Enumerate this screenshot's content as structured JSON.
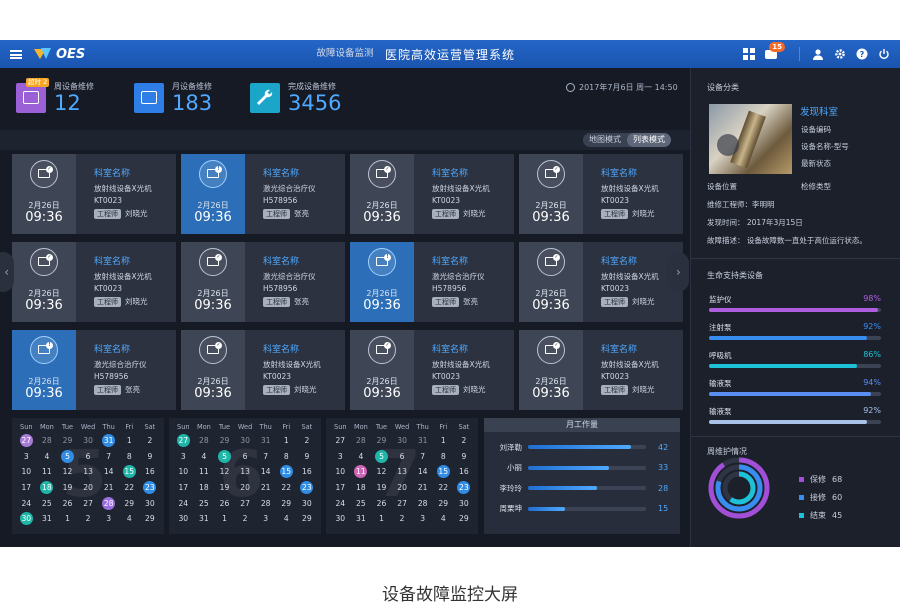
{
  "app": {
    "logo_text": "OES",
    "title": "医院高效运营管理系统",
    "message_count": "15"
  },
  "stats": [
    {
      "label": "周设备维修",
      "value": "12",
      "badge": "超时 2",
      "color": "#9b5fd6"
    },
    {
      "label": "月设备维修",
      "value": "183",
      "color": "#2f7de6"
    },
    {
      "label": "完成设备维修",
      "value": "3456",
      "color": "#1aa5c9"
    }
  ],
  "datetime": "2017年7月6日   周一   14:50",
  "monitor": {
    "title": "故障设备监测",
    "modes": [
      "地图模式",
      "列表模式"
    ],
    "active_mode": "列表模式",
    "engineer_tag": "工程师",
    "cards": [
      {
        "room": "科室名称",
        "device": "放射线设备X光机",
        "code": "KT0023",
        "engineer": "刘晓光",
        "date": "2月26日",
        "time": "09:36",
        "alert": false
      },
      {
        "room": "科室名称",
        "device": "激光综合治疗仪",
        "code": "H578956",
        "engineer": "张亮",
        "date": "2月26日",
        "time": "09:36",
        "alert": true
      },
      {
        "room": "科室名称",
        "device": "放射线设备X光机",
        "code": "KT0023",
        "engineer": "刘晓光",
        "date": "2月26日",
        "time": "09:36",
        "alert": false
      },
      {
        "room": "科室名称",
        "device": "放射线设备X光机",
        "code": "KT0023",
        "engineer": "刘晓光",
        "date": "2月26日",
        "time": "09:36",
        "alert": false
      },
      {
        "room": "科室名称",
        "device": "放射线设备X光机",
        "code": "KT0023",
        "engineer": "刘晓光",
        "date": "2月26日",
        "time": "09:36",
        "alert": false
      },
      {
        "room": "科室名称",
        "device": "激光综合治疗仪",
        "code": "H578956",
        "engineer": "张亮",
        "date": "2月26日",
        "time": "09:36",
        "alert": false
      },
      {
        "room": "科室名称",
        "device": "激光综合治疗仪",
        "code": "H578956",
        "engineer": "张亮",
        "date": "2月26日",
        "time": "09:36",
        "alert": true
      },
      {
        "room": "科室名称",
        "device": "放射线设备X光机",
        "code": "KT0023",
        "engineer": "刘晓光",
        "date": "2月26日",
        "time": "09:36",
        "alert": false
      },
      {
        "room": "科室名称",
        "device": "激光综合治疗仪",
        "code": "H578956",
        "engineer": "张亮",
        "date": "2月26日",
        "time": "09:36",
        "alert": true
      },
      {
        "room": "科室名称",
        "device": "放射线设备X光机",
        "code": "KT0023",
        "engineer": "刘晓光",
        "date": "2月26日",
        "time": "09:36",
        "alert": false
      },
      {
        "room": "科室名称",
        "device": "放射线设备X光机",
        "code": "KT0023",
        "engineer": "刘晓光",
        "date": "2月26日",
        "time": "09:36",
        "alert": false
      },
      {
        "room": "科室名称",
        "device": "放射线设备X光机",
        "code": "KT0023",
        "engineer": "刘晓光",
        "date": "2月26日",
        "time": "09:36",
        "alert": false
      }
    ]
  },
  "calendar": {
    "weekdays": [
      "Sun",
      "Mon",
      "Tue",
      "Wed",
      "Thu",
      "Fri",
      "Sat"
    ],
    "months": [
      {
        "number": "5",
        "rows": [
          [
            [
              "27",
              "purple"
            ],
            [
              "28",
              "dim"
            ],
            [
              "29",
              "dim"
            ],
            [
              "30",
              "dim"
            ],
            [
              "31",
              "blue"
            ],
            [
              "1",
              ""
            ],
            [
              "2",
              ""
            ]
          ],
          [
            [
              "3",
              ""
            ],
            [
              "4",
              ""
            ],
            [
              "5",
              "blue"
            ],
            [
              "6",
              ""
            ],
            [
              "7",
              ""
            ],
            [
              "8",
              ""
            ],
            [
              "9",
              ""
            ]
          ],
          [
            [
              "10",
              ""
            ],
            [
              "11",
              ""
            ],
            [
              "12",
              ""
            ],
            [
              "13",
              ""
            ],
            [
              "14",
              ""
            ],
            [
              "15",
              "teal"
            ],
            [
              "16",
              ""
            ]
          ],
          [
            [
              "17",
              ""
            ],
            [
              "18",
              "teal"
            ],
            [
              "19",
              ""
            ],
            [
              "20",
              ""
            ],
            [
              "21",
              ""
            ],
            [
              "22",
              ""
            ],
            [
              "23",
              "blue"
            ]
          ],
          [
            [
              "24",
              ""
            ],
            [
              "25",
              ""
            ],
            [
              "26",
              ""
            ],
            [
              "27",
              ""
            ],
            [
              "28",
              "vio"
            ],
            [
              "29",
              ""
            ],
            [
              "30",
              ""
            ]
          ],
          [
            [
              "30",
              "teal"
            ],
            [
              "31",
              ""
            ],
            [
              "1",
              ""
            ],
            [
              "2",
              ""
            ],
            [
              "3",
              ""
            ],
            [
              "4",
              ""
            ],
            [
              "29",
              ""
            ]
          ]
        ]
      },
      {
        "number": "6",
        "rows": [
          [
            [
              "27",
              "teal"
            ],
            [
              "28",
              "dim"
            ],
            [
              "29",
              "dim"
            ],
            [
              "30",
              "dim"
            ],
            [
              "31",
              "dim"
            ],
            [
              "1",
              ""
            ],
            [
              "2",
              ""
            ]
          ],
          [
            [
              "3",
              ""
            ],
            [
              "4",
              ""
            ],
            [
              "5",
              "teal"
            ],
            [
              "6",
              ""
            ],
            [
              "7",
              ""
            ],
            [
              "8",
              ""
            ],
            [
              "9",
              ""
            ]
          ],
          [
            [
              "10",
              ""
            ],
            [
              "11",
              ""
            ],
            [
              "12",
              ""
            ],
            [
              "13",
              ""
            ],
            [
              "14",
              ""
            ],
            [
              "15",
              "blue"
            ],
            [
              "16",
              ""
            ]
          ],
          [
            [
              "17",
              ""
            ],
            [
              "18",
              ""
            ],
            [
              "19",
              ""
            ],
            [
              "20",
              ""
            ],
            [
              "21",
              ""
            ],
            [
              "22",
              ""
            ],
            [
              "23",
              "blue"
            ]
          ],
          [
            [
              "24",
              ""
            ],
            [
              "25",
              ""
            ],
            [
              "26",
              ""
            ],
            [
              "27",
              ""
            ],
            [
              "28",
              ""
            ],
            [
              "29",
              ""
            ],
            [
              "30",
              ""
            ]
          ],
          [
            [
              "30",
              ""
            ],
            [
              "31",
              ""
            ],
            [
              "1",
              ""
            ],
            [
              "2",
              ""
            ],
            [
              "3",
              ""
            ],
            [
              "4",
              ""
            ],
            [
              "29",
              ""
            ]
          ]
        ]
      },
      {
        "number": "7",
        "rows": [
          [
            [
              "27",
              ""
            ],
            [
              "28",
              "dim"
            ],
            [
              "29",
              "dim"
            ],
            [
              "30",
              "dim"
            ],
            [
              "31",
              "dim"
            ],
            [
              "1",
              ""
            ],
            [
              "2",
              ""
            ]
          ],
          [
            [
              "3",
              ""
            ],
            [
              "4",
              ""
            ],
            [
              "5",
              "teal"
            ],
            [
              "6",
              ""
            ],
            [
              "7",
              ""
            ],
            [
              "8",
              ""
            ],
            [
              "9",
              ""
            ]
          ],
          [
            [
              "10",
              ""
            ],
            [
              "11",
              "pink"
            ],
            [
              "12",
              ""
            ],
            [
              "13",
              ""
            ],
            [
              "14",
              ""
            ],
            [
              "15",
              "blue"
            ],
            [
              "16",
              ""
            ]
          ],
          [
            [
              "17",
              ""
            ],
            [
              "18",
              ""
            ],
            [
              "19",
              ""
            ],
            [
              "20",
              ""
            ],
            [
              "21",
              ""
            ],
            [
              "22",
              ""
            ],
            [
              "23",
              "blue"
            ]
          ],
          [
            [
              "24",
              ""
            ],
            [
              "25",
              ""
            ],
            [
              "26",
              ""
            ],
            [
              "27",
              ""
            ],
            [
              "28",
              ""
            ],
            [
              "29",
              ""
            ],
            [
              "30",
              ""
            ]
          ],
          [
            [
              "30",
              ""
            ],
            [
              "31",
              ""
            ],
            [
              "1",
              ""
            ],
            [
              "2",
              ""
            ],
            [
              "3",
              ""
            ],
            [
              "4",
              ""
            ],
            [
              "29",
              ""
            ]
          ]
        ]
      }
    ]
  },
  "workload": {
    "title": "月工作量",
    "rows": [
      {
        "name": "刘泽勒",
        "value": 42,
        "max": 48
      },
      {
        "name": "小丽",
        "value": 33,
        "max": 48
      },
      {
        "name": "李玲玲",
        "value": 28,
        "max": 48
      },
      {
        "name": "周栗坤",
        "value": 15,
        "max": 48
      }
    ]
  },
  "equipment": {
    "section_title": "设备分类",
    "room": "发现科室",
    "lines": [
      "设备编码",
      "设备名称-型号",
      "最新状态"
    ],
    "location_label": "设备位置",
    "type_label": "检修类型",
    "engineer": "维修工程师：李明明",
    "found_time": "发现时间：  2017年3月15日",
    "fault_desc": "故障描述：  设备故障数一直处于高位运行状态。"
  },
  "life_support": {
    "title": "生命支持类设备",
    "items": [
      {
        "name": "监护仪",
        "percent": "98%",
        "fraction": 0.98,
        "color": "#b05ee0"
      },
      {
        "name": "注射泵",
        "percent": "92%",
        "fraction": 0.92,
        "color": "#3a8df0"
      },
      {
        "name": "呼吸机",
        "percent": "86%",
        "fraction": 0.86,
        "color": "#1ec2d8"
      },
      {
        "name": "输液泵",
        "percent": "94%",
        "fraction": 0.94,
        "color": "#5a8ef0"
      },
      {
        "name": "输液泵",
        "percent": "92%",
        "fraction": 0.92,
        "color": "#a9c2e8"
      }
    ]
  },
  "maintenance": {
    "title": "周维护情况",
    "legend": [
      {
        "label": "保修",
        "value": "68",
        "color": "#a24fd8"
      },
      {
        "label": "接修",
        "value": "60",
        "color": "#3a8df0"
      },
      {
        "label": "结束",
        "value": "45",
        "color": "#1ec2d8"
      }
    ]
  },
  "caption": "设备故障监控大屏"
}
